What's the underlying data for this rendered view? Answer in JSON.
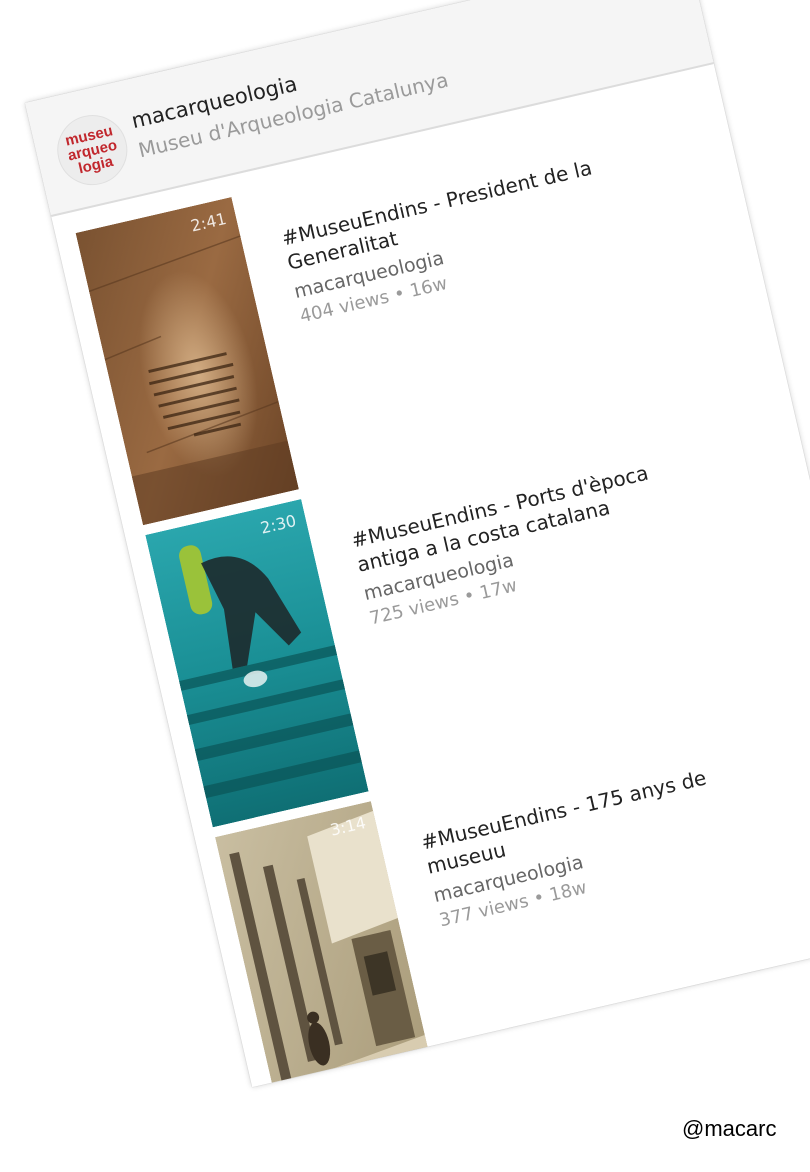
{
  "channel": {
    "avatar_lines": [
      "museu",
      "arqueo",
      "logia"
    ],
    "name": "macarqueologia",
    "subtitle": "Museu d'Arqueologia Catalunya"
  },
  "videos": [
    {
      "duration": "2:41",
      "title_line1": "#MuseuEndins - President de la",
      "title_line2": "Generalitat",
      "author": "macarqueologia",
      "stats": "404 views • 16w"
    },
    {
      "duration": "2:30",
      "title_line1": "#MuseuEndins - Ports d'època",
      "title_line2": "antiga a la costa catalana",
      "author": "macarqueologia",
      "stats": "725 views • 17w"
    },
    {
      "duration": "3:14",
      "title_line1": "#MuseuEndins - 175 anys de",
      "title_line2": "museuu",
      "author": "macarqueologia",
      "stats": "377 views • 18w"
    }
  ],
  "watermark": "@macarc",
  "colors": {
    "brand_red": "#c1272d",
    "header_bg": "#f5f5f5",
    "secondary_text": "#9a9a9a"
  }
}
